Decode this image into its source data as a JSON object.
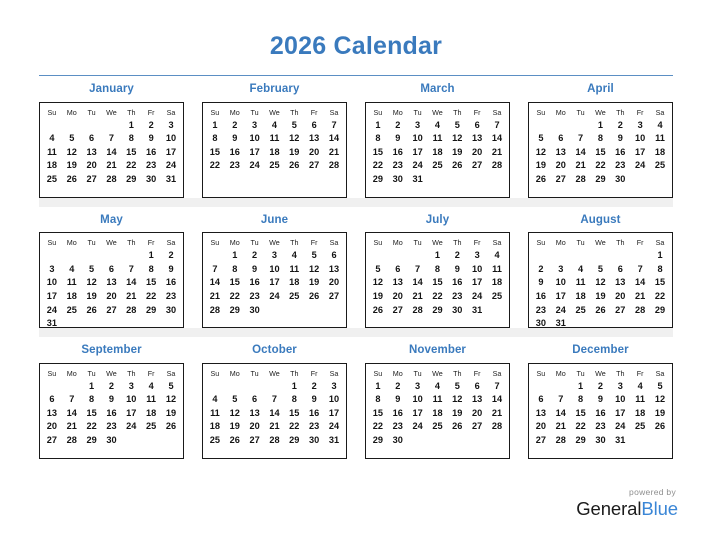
{
  "header": {
    "title": "2026 Calendar",
    "accent_color": "#3a7abd",
    "rule_color": "#5b8fc4"
  },
  "weekday_headers": [
    "Su",
    "Mo",
    "Tu",
    "We",
    "Th",
    "Fr",
    "Sa"
  ],
  "footer": {
    "powered_by": "powered by",
    "brand_first": "General",
    "brand_second": "Blue",
    "brand_first_color": "#1b1b1b",
    "brand_second_color": "#3a86d6"
  },
  "chart_data": {
    "type": "table",
    "title": "2026 Calendar",
    "year": 2026,
    "week_start": "Sunday",
    "layout": {
      "rows": 3,
      "columns": 4
    },
    "months": [
      {
        "name": "January",
        "index": 1,
        "days": 31,
        "first_weekday": "Th",
        "first_weekday_index": 4,
        "weeks": [
          [
            "",
            "",
            "",
            "",
            "1",
            "2",
            "3"
          ],
          [
            "4",
            "5",
            "6",
            "7",
            "8",
            "9",
            "10"
          ],
          [
            "11",
            "12",
            "13",
            "14",
            "15",
            "16",
            "17"
          ],
          [
            "18",
            "19",
            "20",
            "21",
            "22",
            "23",
            "24"
          ],
          [
            "25",
            "26",
            "27",
            "28",
            "29",
            "30",
            "31"
          ],
          [
            "",
            "",
            "",
            "",
            "",
            "",
            ""
          ]
        ]
      },
      {
        "name": "February",
        "index": 2,
        "days": 28,
        "first_weekday": "Su",
        "first_weekday_index": 0,
        "weeks": [
          [
            "1",
            "2",
            "3",
            "4",
            "5",
            "6",
            "7"
          ],
          [
            "8",
            "9",
            "10",
            "11",
            "12",
            "13",
            "14"
          ],
          [
            "15",
            "16",
            "17",
            "18",
            "19",
            "20",
            "21"
          ],
          [
            "22",
            "23",
            "24",
            "25",
            "26",
            "27",
            "28"
          ],
          [
            "",
            "",
            "",
            "",
            "",
            "",
            ""
          ],
          [
            "",
            "",
            "",
            "",
            "",
            "",
            ""
          ]
        ]
      },
      {
        "name": "March",
        "index": 3,
        "days": 31,
        "first_weekday": "Su",
        "first_weekday_index": 0,
        "weeks": [
          [
            "1",
            "2",
            "3",
            "4",
            "5",
            "6",
            "7"
          ],
          [
            "8",
            "9",
            "10",
            "11",
            "12",
            "13",
            "14"
          ],
          [
            "15",
            "16",
            "17",
            "18",
            "19",
            "20",
            "21"
          ],
          [
            "22",
            "23",
            "24",
            "25",
            "26",
            "27",
            "28"
          ],
          [
            "29",
            "30",
            "31",
            "",
            "",
            "",
            ""
          ],
          [
            "",
            "",
            "",
            "",
            "",
            "",
            ""
          ]
        ]
      },
      {
        "name": "April",
        "index": 4,
        "days": 30,
        "first_weekday": "We",
        "first_weekday_index": 3,
        "weeks": [
          [
            "",
            "",
            "",
            "1",
            "2",
            "3",
            "4"
          ],
          [
            "5",
            "6",
            "7",
            "8",
            "9",
            "10",
            "11"
          ],
          [
            "12",
            "13",
            "14",
            "15",
            "16",
            "17",
            "18"
          ],
          [
            "19",
            "20",
            "21",
            "22",
            "23",
            "24",
            "25"
          ],
          [
            "26",
            "27",
            "28",
            "29",
            "30",
            "",
            ""
          ],
          [
            "",
            "",
            "",
            "",
            "",
            "",
            ""
          ]
        ]
      },
      {
        "name": "May",
        "index": 5,
        "days": 31,
        "first_weekday": "Fr",
        "first_weekday_index": 5,
        "weeks": [
          [
            "",
            "",
            "",
            "",
            "",
            "1",
            "2"
          ],
          [
            "3",
            "4",
            "5",
            "6",
            "7",
            "8",
            "9"
          ],
          [
            "10",
            "11",
            "12",
            "13",
            "14",
            "15",
            "16"
          ],
          [
            "17",
            "18",
            "19",
            "20",
            "21",
            "22",
            "23"
          ],
          [
            "24",
            "25",
            "26",
            "27",
            "28",
            "29",
            "30"
          ],
          [
            "31",
            "",
            "",
            "",
            "",
            "",
            ""
          ]
        ]
      },
      {
        "name": "June",
        "index": 6,
        "days": 30,
        "first_weekday": "Mo",
        "first_weekday_index": 1,
        "weeks": [
          [
            "",
            "1",
            "2",
            "3",
            "4",
            "5",
            "6"
          ],
          [
            "7",
            "8",
            "9",
            "10",
            "11",
            "12",
            "13"
          ],
          [
            "14",
            "15",
            "16",
            "17",
            "18",
            "19",
            "20"
          ],
          [
            "21",
            "22",
            "23",
            "24",
            "25",
            "26",
            "27"
          ],
          [
            "28",
            "29",
            "30",
            "",
            "",
            "",
            ""
          ],
          [
            "",
            "",
            "",
            "",
            "",
            "",
            ""
          ]
        ]
      },
      {
        "name": "July",
        "index": 7,
        "days": 31,
        "first_weekday": "We",
        "first_weekday_index": 3,
        "weeks": [
          [
            "",
            "",
            "",
            "1",
            "2",
            "3",
            "4"
          ],
          [
            "5",
            "6",
            "7",
            "8",
            "9",
            "10",
            "11"
          ],
          [
            "12",
            "13",
            "14",
            "15",
            "16",
            "17",
            "18"
          ],
          [
            "19",
            "20",
            "21",
            "22",
            "23",
            "24",
            "25"
          ],
          [
            "26",
            "27",
            "28",
            "29",
            "30",
            "31",
            ""
          ],
          [
            "",
            "",
            "",
            "",
            "",
            "",
            ""
          ]
        ]
      },
      {
        "name": "August",
        "index": 8,
        "days": 31,
        "first_weekday": "Sa",
        "first_weekday_index": 6,
        "weeks": [
          [
            "",
            "",
            "",
            "",
            "",
            "",
            "1"
          ],
          [
            "2",
            "3",
            "4",
            "5",
            "6",
            "7",
            "8"
          ],
          [
            "9",
            "10",
            "11",
            "12",
            "13",
            "14",
            "15"
          ],
          [
            "16",
            "17",
            "18",
            "19",
            "20",
            "21",
            "22"
          ],
          [
            "23",
            "24",
            "25",
            "26",
            "27",
            "28",
            "29"
          ],
          [
            "30",
            "31",
            "",
            "",
            "",
            "",
            ""
          ]
        ]
      },
      {
        "name": "September",
        "index": 9,
        "days": 30,
        "first_weekday": "Tu",
        "first_weekday_index": 2,
        "weeks": [
          [
            "",
            "",
            "1",
            "2",
            "3",
            "4",
            "5"
          ],
          [
            "6",
            "7",
            "8",
            "9",
            "10",
            "11",
            "12"
          ],
          [
            "13",
            "14",
            "15",
            "16",
            "17",
            "18",
            "19"
          ],
          [
            "20",
            "21",
            "22",
            "23",
            "24",
            "25",
            "26"
          ],
          [
            "27",
            "28",
            "29",
            "30",
            "",
            "",
            ""
          ],
          [
            "",
            "",
            "",
            "",
            "",
            "",
            ""
          ]
        ]
      },
      {
        "name": "October",
        "index": 10,
        "days": 31,
        "first_weekday": "Th",
        "first_weekday_index": 4,
        "weeks": [
          [
            "",
            "",
            "",
            "",
            "1",
            "2",
            "3"
          ],
          [
            "4",
            "5",
            "6",
            "7",
            "8",
            "9",
            "10"
          ],
          [
            "11",
            "12",
            "13",
            "14",
            "15",
            "16",
            "17"
          ],
          [
            "18",
            "19",
            "20",
            "21",
            "22",
            "23",
            "24"
          ],
          [
            "25",
            "26",
            "27",
            "28",
            "29",
            "30",
            "31"
          ],
          [
            "",
            "",
            "",
            "",
            "",
            "",
            ""
          ]
        ]
      },
      {
        "name": "November",
        "index": 11,
        "days": 30,
        "first_weekday": "Su",
        "first_weekday_index": 0,
        "weeks": [
          [
            "1",
            "2",
            "3",
            "4",
            "5",
            "6",
            "7"
          ],
          [
            "8",
            "9",
            "10",
            "11",
            "12",
            "13",
            "14"
          ],
          [
            "15",
            "16",
            "17",
            "18",
            "19",
            "20",
            "21"
          ],
          [
            "22",
            "23",
            "24",
            "25",
            "26",
            "27",
            "28"
          ],
          [
            "29",
            "30",
            "",
            "",
            "",
            "",
            ""
          ],
          [
            "",
            "",
            "",
            "",
            "",
            "",
            ""
          ]
        ]
      },
      {
        "name": "December",
        "index": 12,
        "days": 31,
        "first_weekday": "Tu",
        "first_weekday_index": 2,
        "weeks": [
          [
            "",
            "",
            "1",
            "2",
            "3",
            "4",
            "5"
          ],
          [
            "6",
            "7",
            "8",
            "9",
            "10",
            "11",
            "12"
          ],
          [
            "13",
            "14",
            "15",
            "16",
            "17",
            "18",
            "19"
          ],
          [
            "20",
            "21",
            "22",
            "23",
            "24",
            "25",
            "26"
          ],
          [
            "27",
            "28",
            "29",
            "30",
            "31",
            "",
            ""
          ],
          [
            "",
            "",
            "",
            "",
            "",
            "",
            ""
          ]
        ]
      }
    ]
  }
}
